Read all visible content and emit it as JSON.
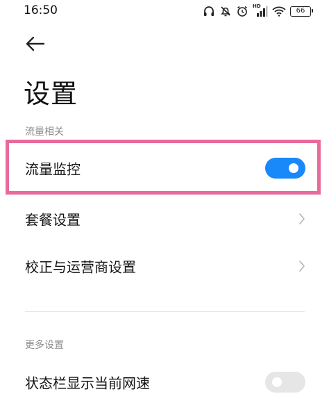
{
  "status_bar": {
    "time": "16:50",
    "icons": [
      "headset-icon",
      "mute-icon",
      "alarm-icon",
      "hd-signal-icon",
      "wifi-icon",
      "battery-icon"
    ],
    "hd_label": "HD",
    "battery_level": "66"
  },
  "header": {
    "title": "设置"
  },
  "sections": [
    {
      "header": "流量相关",
      "items": [
        {
          "label": "流量监控",
          "control": "toggle",
          "state": "on"
        },
        {
          "label": "套餐设置",
          "control": "chevron"
        },
        {
          "label": "校正与运营商设置",
          "control": "chevron"
        }
      ]
    },
    {
      "header": "更多设置",
      "items": [
        {
          "label": "状态栏显示当前网速",
          "control": "toggle",
          "state": "off"
        }
      ]
    }
  ],
  "colors": {
    "accent": "#1989fa",
    "highlight": "#e76a9b",
    "toggle_off": "#e6e6e6",
    "section_header": "#8c8c8c"
  }
}
